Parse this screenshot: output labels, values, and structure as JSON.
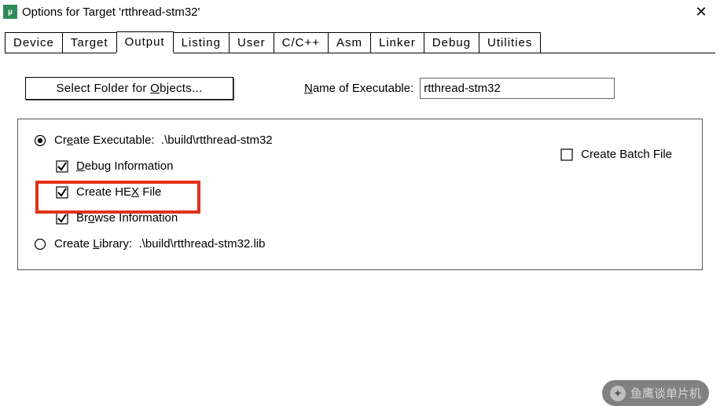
{
  "window": {
    "title": "Options for Target 'rtthread-stm32'",
    "close_label": "✕"
  },
  "tabs": [
    {
      "label": "Device"
    },
    {
      "label": "Target"
    },
    {
      "label": "Output"
    },
    {
      "label": "Listing"
    },
    {
      "label": "User"
    },
    {
      "label": "C/C++"
    },
    {
      "label": "Asm"
    },
    {
      "label": "Linker"
    },
    {
      "label": "Debug"
    },
    {
      "label": "Utilities"
    }
  ],
  "active_tab_index": 2,
  "select_folder_label": "Select Folder for Objects...",
  "name_of_exec_label_pre": "N",
  "name_of_exec_label_rest": "ame of Executable:",
  "exec_name_value": "rtthread-stm32",
  "create_exec": {
    "pre": "Cr",
    "u": "e",
    "post": "ate Executable:",
    "path": ".\\build\\rtthread-stm32"
  },
  "debug_info": {
    "pre": "",
    "u": "D",
    "post": "ebug Information"
  },
  "create_hex": {
    "pre": "Create HE",
    "u": "X",
    "post": " File"
  },
  "browse_info": {
    "pre": "Br",
    "u": "o",
    "post": "wse Information"
  },
  "create_lib": {
    "pre": "Create ",
    "u": "L",
    "post": "ibrary:",
    "path": ".\\build\\rtthread-stm32.lib"
  },
  "create_batch_label": "Create Batch File",
  "watermark": "鱼鹰谈单片机",
  "select_folder_underline": "O"
}
